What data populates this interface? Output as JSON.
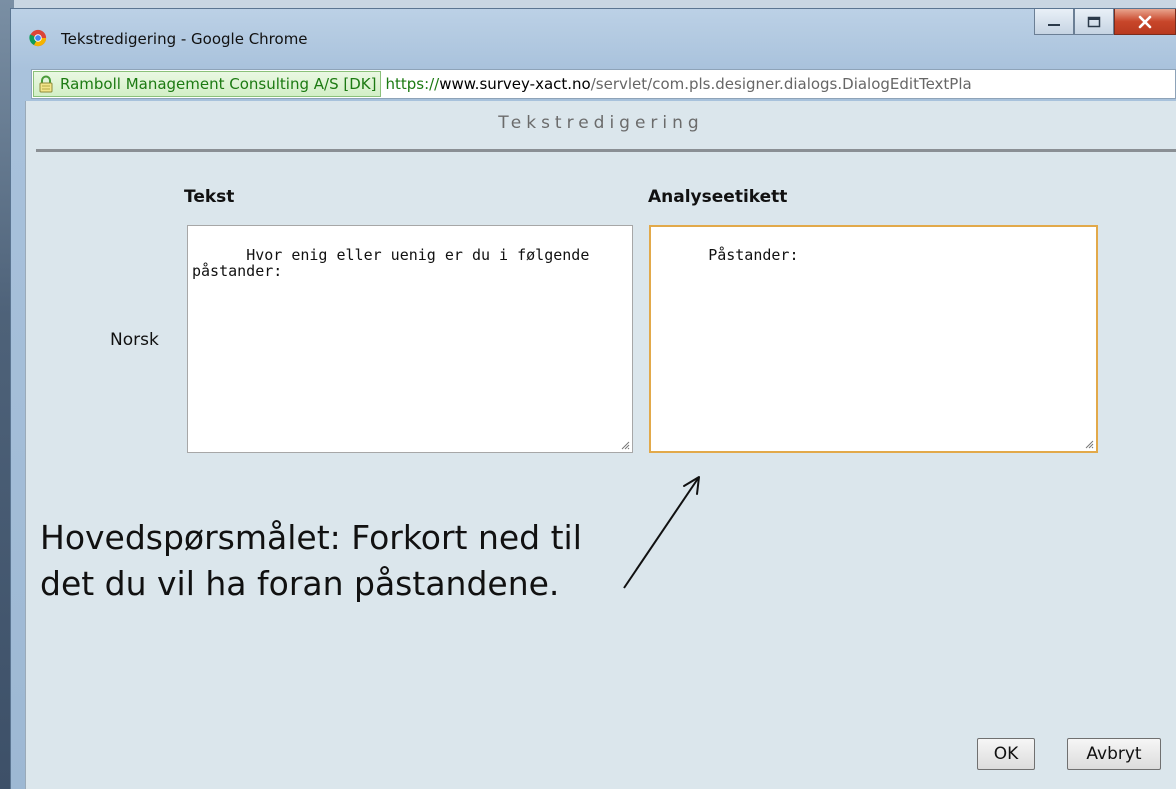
{
  "window": {
    "title": "Tekstredigering - Google Chrome",
    "controls": [
      "minimize-icon",
      "maximize-icon",
      "close-icon"
    ]
  },
  "address_bar": {
    "site_identity": "Ramboll Management Consulting A/S [DK]",
    "url_scheme": "https://",
    "url_host": "www.survey-xact.no",
    "url_path": "/servlet/com.pls.designer.dialogs.DialogEditTextPla"
  },
  "dialog": {
    "title": "Tekstredigering",
    "columns": {
      "text": "Tekst",
      "analysis_label": "Analyseetikett"
    },
    "row_label": "Norsk",
    "text_value": "Hvor enig eller uenig er du i følgende påstander:",
    "analysis_value": "Påstander:",
    "ok_label": "OK",
    "cancel_label": "Avbryt"
  },
  "annotation": {
    "line1": "Hovedspørsmålet: Forkort ned til",
    "line2": "det du vil ha foran påstandene."
  },
  "colors": {
    "focus_border": "#e2a94a",
    "ssl_green": "#1c7a12",
    "dialog_bg": "#dbe6ec"
  }
}
